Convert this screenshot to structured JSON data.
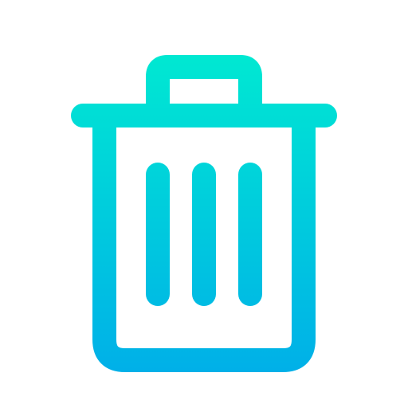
{
  "icon": {
    "name": "trash-icon",
    "colors": {
      "gradient_top": "#00E8D2",
      "gradient_bottom": "#00B0E8",
      "background": "#FFFFFF"
    }
  }
}
